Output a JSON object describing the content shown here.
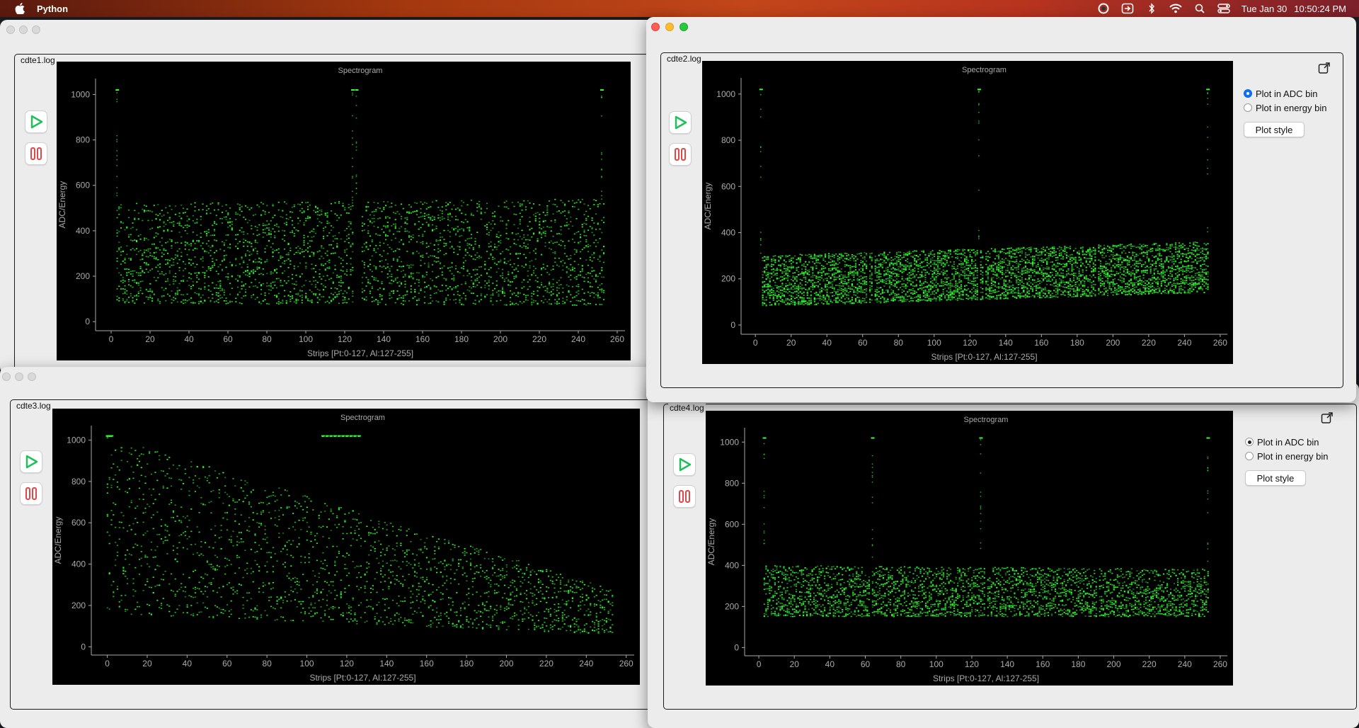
{
  "menubar": {
    "app_name": "Python",
    "date": "Tue Jan 30",
    "time": "10:50:24 PM",
    "icons": [
      "apple-icon",
      "cpu-monitor-icon",
      "screen-share-icon",
      "bluetooth-icon",
      "wifi-icon",
      "search-icon",
      "control-center-icon"
    ]
  },
  "colors": {
    "spectrum": "#33ff33",
    "axis": "#aaaaaa",
    "background": "#000000"
  },
  "panels": [
    {
      "id": "cdte1",
      "title": "cdte1.log",
      "plot_title": "Spectrogram",
      "ylabel": "ADC/Energy",
      "xlabel": "Strips [Pt:0-127, Al:127-255]",
      "play_icon": "play-icon",
      "stop_icon": "pause-icon",
      "has_sidepanel": false,
      "radio_style": "none"
    },
    {
      "id": "cdte2",
      "title": "cdte2.log",
      "plot_title": "Spectrogram",
      "ylabel": "ADC/Energy",
      "xlabel": "Strips [Pt:0-127, Al:127-255]",
      "play_icon": "play-icon",
      "stop_icon": "pause-icon",
      "has_sidepanel": true,
      "radio_style": "blue",
      "radio_adc": "Plot in ADC bin",
      "radio_energy": "Plot in energy bin",
      "plot_style": "Plot style",
      "selected": "adc"
    },
    {
      "id": "cdte3",
      "title": "cdte3.log",
      "plot_title": "Spectrogram",
      "ylabel": "ADC/Energy",
      "xlabel": "Strips [Pt:0-127, Al:127-255]",
      "play_icon": "play-icon",
      "stop_icon": "pause-icon",
      "has_sidepanel": false,
      "radio_style": "none"
    },
    {
      "id": "cdte4",
      "title": "cdte4.log",
      "plot_title": "Spectrogram",
      "ylabel": "ADC/Energy",
      "xlabel": "Strips [Pt:0-127, Al:127-255]",
      "play_icon": "play-icon",
      "stop_icon": "pause-icon",
      "has_sidepanel": true,
      "radio_style": "gray",
      "radio_adc": "Plot in ADC bin",
      "radio_energy": "Plot in energy bin",
      "plot_style": "Plot style",
      "selected": "adc"
    }
  ],
  "chart_data": [
    {
      "type": "heatmap",
      "title": "Spectrogram",
      "xlabel": "Strips [Pt:0-127, Al:127-255]",
      "ylabel": "ADC/Energy",
      "xlim": [
        -8,
        264
      ],
      "ylim": [
        -40,
        1070
      ],
      "xticks": [
        0,
        20,
        40,
        60,
        80,
        100,
        120,
        140,
        160,
        180,
        200,
        220,
        240,
        260
      ],
      "yticks": [
        0,
        200,
        400,
        600,
        800,
        1000
      ],
      "band": {
        "strips": [
          3,
          253
        ],
        "low": [
          80,
          70
        ],
        "high": [
          520,
          540
        ],
        "density": 0.55
      },
      "dead_strips": [
        63,
        125,
        126,
        127,
        128,
        191
      ],
      "saturated_strips": [
        3,
        124,
        126,
        252
      ],
      "saturation_value": 1020
    },
    {
      "type": "heatmap",
      "title": "Spectrogram",
      "xlabel": "Strips [Pt:0-127, Al:127-255]",
      "ylabel": "ADC/Energy",
      "xlim": [
        -8,
        264
      ],
      "ylim": [
        -40,
        1070
      ],
      "xticks": [
        0,
        20,
        40,
        60,
        80,
        100,
        120,
        140,
        160,
        180,
        200,
        220,
        240,
        260
      ],
      "yticks": [
        0,
        200,
        400,
        600,
        800,
        1000
      ],
      "band": {
        "strips": [
          4,
          253
        ],
        "low": [
          80,
          140
        ],
        "high": [
          300,
          360
        ],
        "density": 0.9
      },
      "dead_strips": [
        63,
        66,
        125,
        128,
        191
      ],
      "saturated_strips": [
        3,
        125,
        253
      ],
      "saturation_value": 1020
    },
    {
      "type": "heatmap",
      "title": "Spectrogram",
      "xlabel": "Strips [Pt:0-127, Al:127-255]",
      "ylabel": "ADC/Energy",
      "xlim": [
        -8,
        264
      ],
      "ylim": [
        -40,
        1070
      ],
      "xticks": [
        0,
        20,
        40,
        60,
        80,
        100,
        120,
        140,
        160,
        180,
        200,
        220,
        240,
        260
      ],
      "yticks": [
        0,
        200,
        400,
        600,
        800,
        1000
      ],
      "band": {
        "strips": [
          0,
          253
        ],
        "low": [
          160,
          60
        ],
        "high": [
          1020,
          280
        ],
        "density": 0.35
      },
      "dead_strips": [
        128
      ],
      "saturated_strips": [
        0,
        1,
        2,
        108,
        110,
        112,
        114,
        116,
        118,
        120,
        122,
        124,
        126
      ],
      "saturation_value": 1020
    },
    {
      "type": "heatmap",
      "title": "Spectrogram",
      "xlabel": "Strips [Pt:0-127, Al:127-255]",
      "ylabel": "ADC/Energy",
      "xlim": [
        -8,
        264
      ],
      "ylim": [
        -40,
        1070
      ],
      "xticks": [
        0,
        20,
        40,
        60,
        80,
        100,
        120,
        140,
        160,
        180,
        200,
        220,
        240,
        260
      ],
      "yticks": [
        0,
        200,
        400,
        600,
        800,
        1000
      ],
      "band": {
        "strips": [
          3,
          253
        ],
        "low": [
          150,
          150
        ],
        "high": [
          400,
          380
        ],
        "density": 0.6
      },
      "dead_strips": [
        63,
        128,
        191
      ],
      "saturated_strips": [
        3,
        64,
        125,
        253
      ],
      "saturation_value": 1020
    }
  ]
}
